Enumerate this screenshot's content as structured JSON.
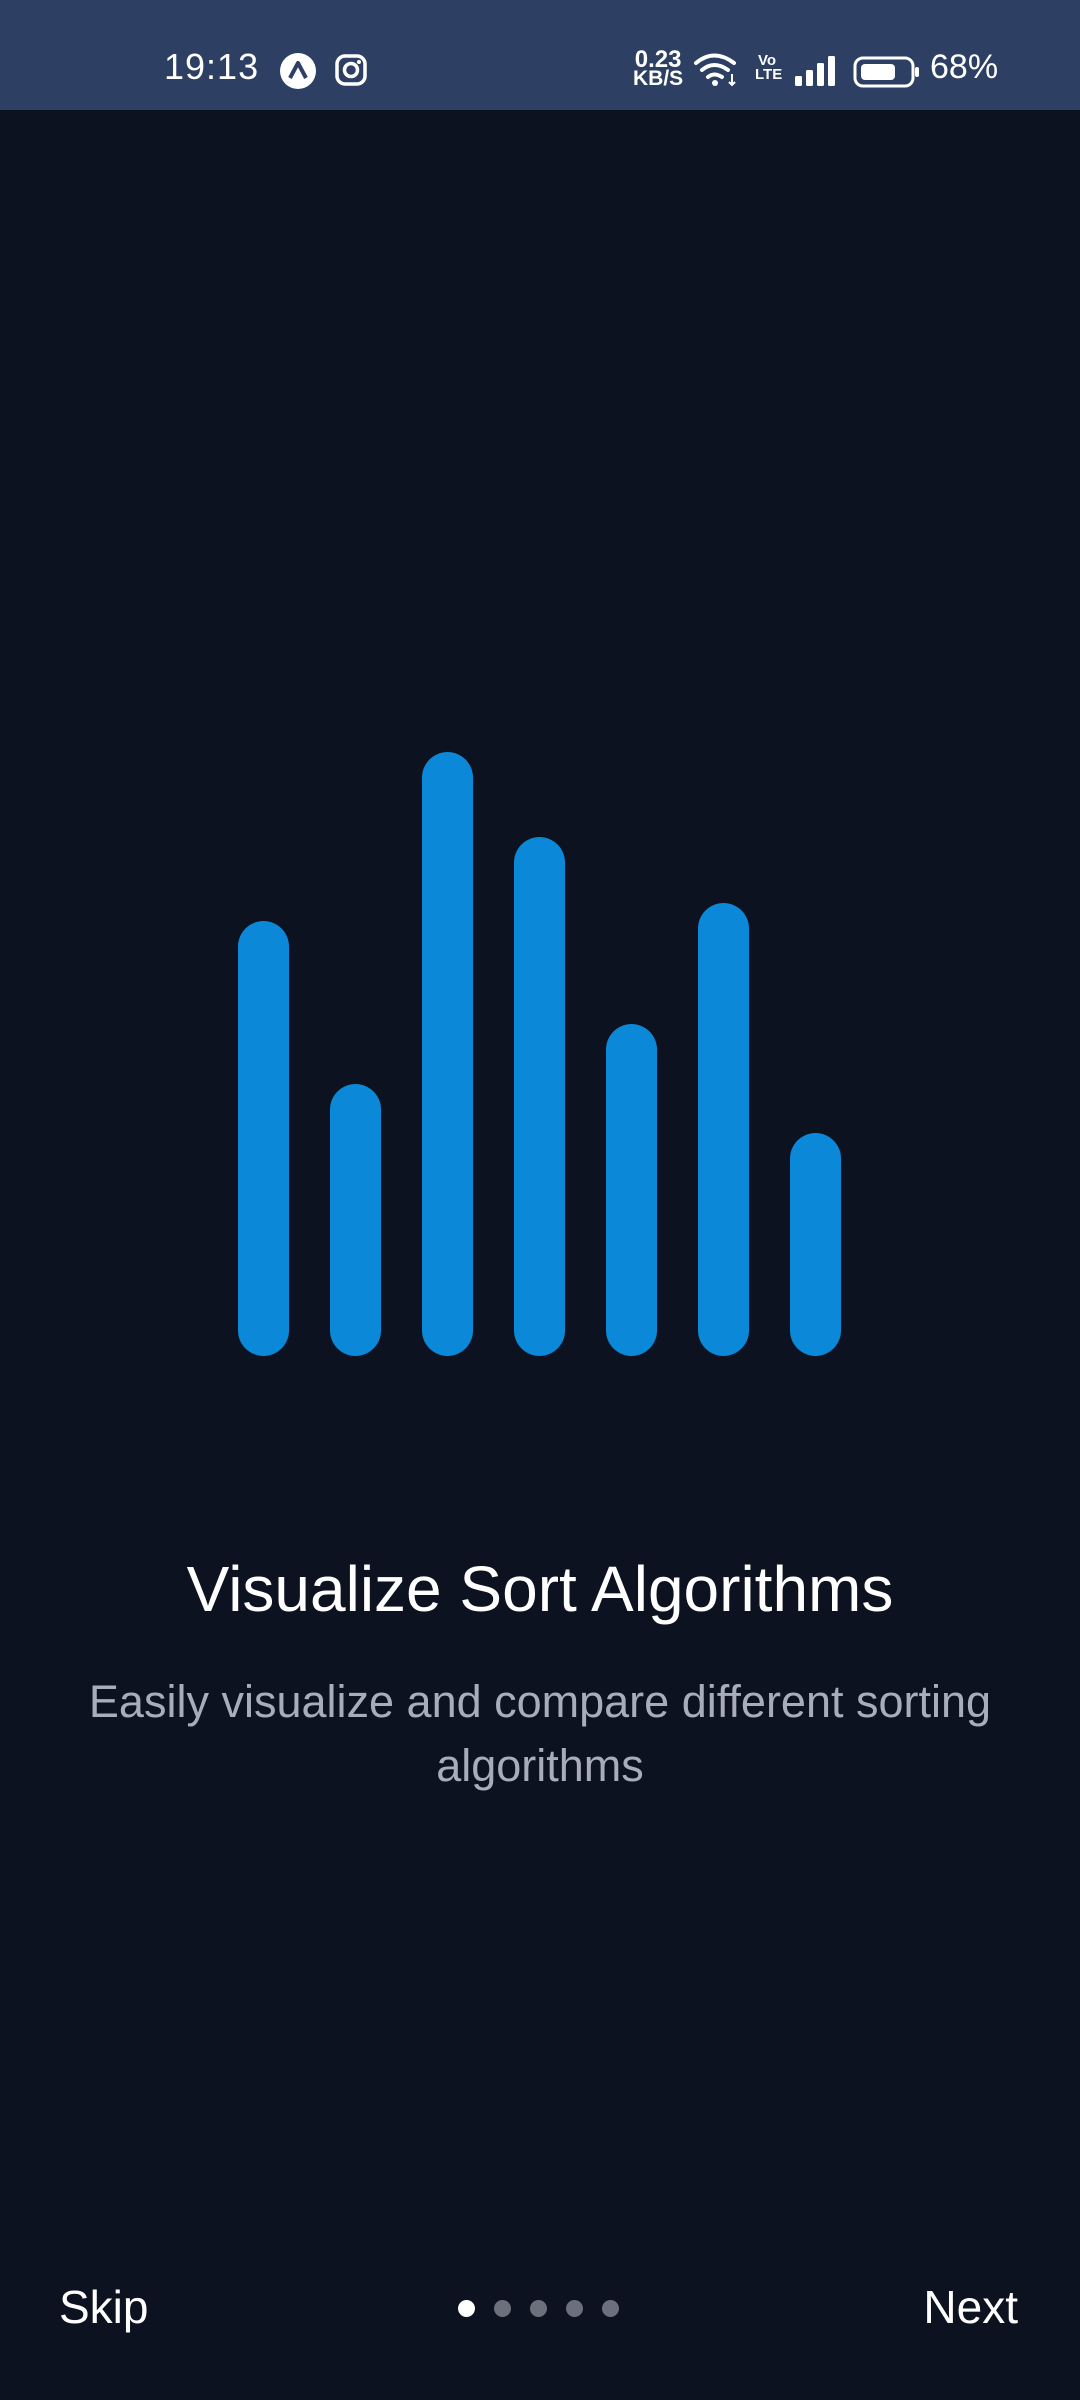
{
  "status_bar": {
    "time": "19:13",
    "net_speed_value": "0.23",
    "net_speed_unit": "KB/S",
    "volte": "Vo LTE",
    "battery_percent": "68%",
    "icons": [
      "expo-app-icon",
      "instagram-icon",
      "wifi-icon",
      "volte-icon",
      "signal-icon",
      "battery-icon"
    ]
  },
  "onboarding": {
    "illustration_icon": "sort-bars-icon",
    "accent_color": "#0b88d8",
    "bars_relative_heights": [
      0.72,
      0.45,
      1.0,
      0.86,
      0.55,
      0.75,
      0.37
    ],
    "title": "Visualize Sort Algorithms",
    "subtitle": "Easily visualize and compare different sorting algorithms"
  },
  "footer": {
    "skip_label": "Skip",
    "next_label": "Next",
    "page_count": 5,
    "active_page": 1
  }
}
